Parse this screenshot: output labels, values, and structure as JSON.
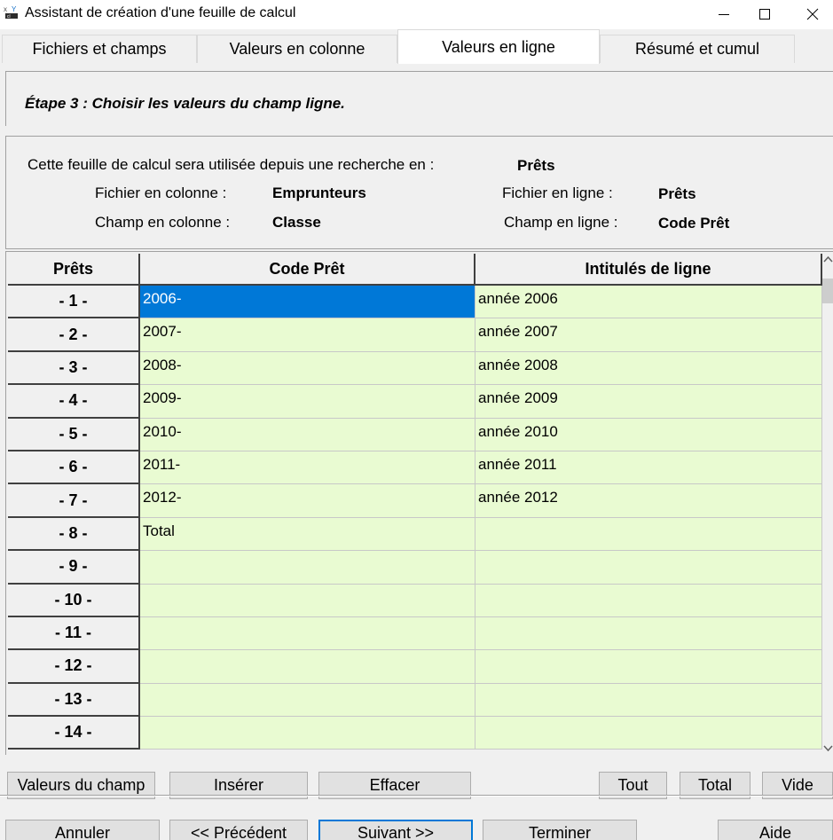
{
  "window": {
    "title": "Assistant de création d'une feuille de calcul",
    "icon": "spreadsheet-app-icon"
  },
  "tabs": [
    {
      "label": "Fichiers et champs",
      "active": false
    },
    {
      "label": "Valeurs en colonne",
      "active": false
    },
    {
      "label": "Valeurs en ligne",
      "active": true
    },
    {
      "label": "Résumé et cumul",
      "active": false
    }
  ],
  "step": {
    "title": "Étape 3 :  Choisir les valeurs du champ ligne."
  },
  "info": {
    "search_label": "Cette feuille de calcul sera utilisée depuis une recherche en :",
    "search_value": "Prêts",
    "col_file_label": "Fichier en colonne :",
    "col_file_value": "Emprunteurs",
    "col_field_label": "Champ en colonne :",
    "col_field_value": "Classe",
    "row_file_label": "Fichier en ligne :",
    "row_file_value": "Prêts",
    "row_field_label": "Champ en ligne :",
    "row_field_value": "Code Prêt"
  },
  "grid": {
    "headers": [
      "Prêts",
      "Code Prêt",
      "Intitulés de ligne"
    ],
    "rows": [
      {
        "num": "- 1 -",
        "code": "2006-",
        "label": "année 2006"
      },
      {
        "num": "- 2 -",
        "code": "2007-",
        "label": "année 2007"
      },
      {
        "num": "- 3 -",
        "code": "2008-",
        "label": "année 2008"
      },
      {
        "num": "- 4 -",
        "code": "2009-",
        "label": "année 2009"
      },
      {
        "num": "- 5 -",
        "code": "2010-",
        "label": "année 2010"
      },
      {
        "num": "- 6 -",
        "code": "2011-",
        "label": "année 2011"
      },
      {
        "num": "- 7 -",
        "code": "2012-",
        "label": "année 2012"
      },
      {
        "num": "- 8 -",
        "code": "Total",
        "label": ""
      },
      {
        "num": "- 9 -",
        "code": "",
        "label": ""
      },
      {
        "num": "- 10 -",
        "code": "",
        "label": ""
      },
      {
        "num": "- 11 -",
        "code": "",
        "label": ""
      },
      {
        "num": "- 12 -",
        "code": "",
        "label": ""
      },
      {
        "num": "- 13 -",
        "code": "",
        "label": ""
      },
      {
        "num": "- 14 -",
        "code": "",
        "label": ""
      }
    ],
    "selected_row": 0
  },
  "grid_buttons": {
    "field_values": "Valeurs du champ",
    "insert": "Insérer",
    "clear": "Effacer",
    "all": "Tout",
    "total": "Total",
    "empty": "Vide"
  },
  "footer_buttons": {
    "cancel": "Annuler",
    "previous": "<< Précédent",
    "next": "Suivant >>",
    "finish": "Terminer",
    "help": "Aide"
  },
  "colors": {
    "cell_bg": "#e9fbd2",
    "selection": "#0078d7",
    "panel_bg": "#f0f0f0"
  }
}
